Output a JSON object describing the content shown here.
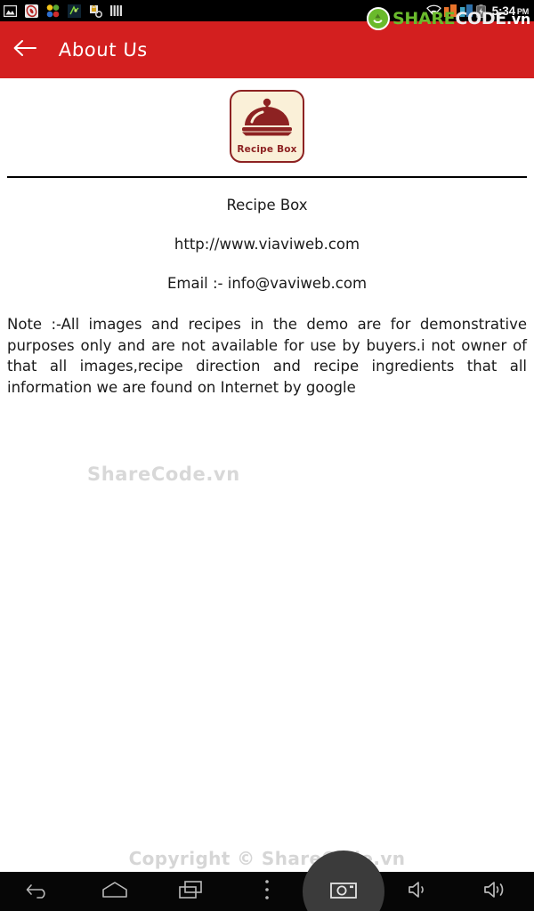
{
  "statusbar": {
    "icons": [
      "image-icon",
      "browser-icon",
      "colors-icon",
      "maps-icon",
      "security-icon",
      "bars-icon"
    ],
    "wifi_icon": "wifi-icon",
    "signal_orange_icon": "signal-orange-icon",
    "signal_blue_icon": "signal-blue-icon",
    "battery_icon": "battery-charging-icon",
    "time": "5:34",
    "ampm": "PM"
  },
  "watermark": {
    "brand_share": "SHARE",
    "brand_code": "CODE",
    "brand_vn": ".vn",
    "center_text": "ShareCode.vn",
    "copyright": "Copyright © ShareCode.vn"
  },
  "appbar": {
    "back_icon": "back-arrow-icon",
    "title": "About Us",
    "bg_color": "#d31f1f"
  },
  "logo": {
    "label": "Recipe Box",
    "icon": "cloche-icon",
    "bg_color": "#faf0d8",
    "accent_color": "#8d2222"
  },
  "about": {
    "app_name": "Recipe Box",
    "website": "http://www.viaviweb.com",
    "email": "Email :- info@vaviweb.com",
    "note": "Note :-All images and recipes in the demo are for demonstrative purposes only and are not available for use by buyers.i not owner of that all images,recipe direction and recipe ingredients that all information we are found on Internet by google"
  },
  "navbar": {
    "back": "back-icon",
    "home": "home-icon",
    "recents": "recents-icon",
    "menu": "overflow-menu-icon",
    "screenshot": "screenshot-camera-icon",
    "volume_down": "volume-down-icon",
    "volume_up": "volume-up-icon"
  }
}
